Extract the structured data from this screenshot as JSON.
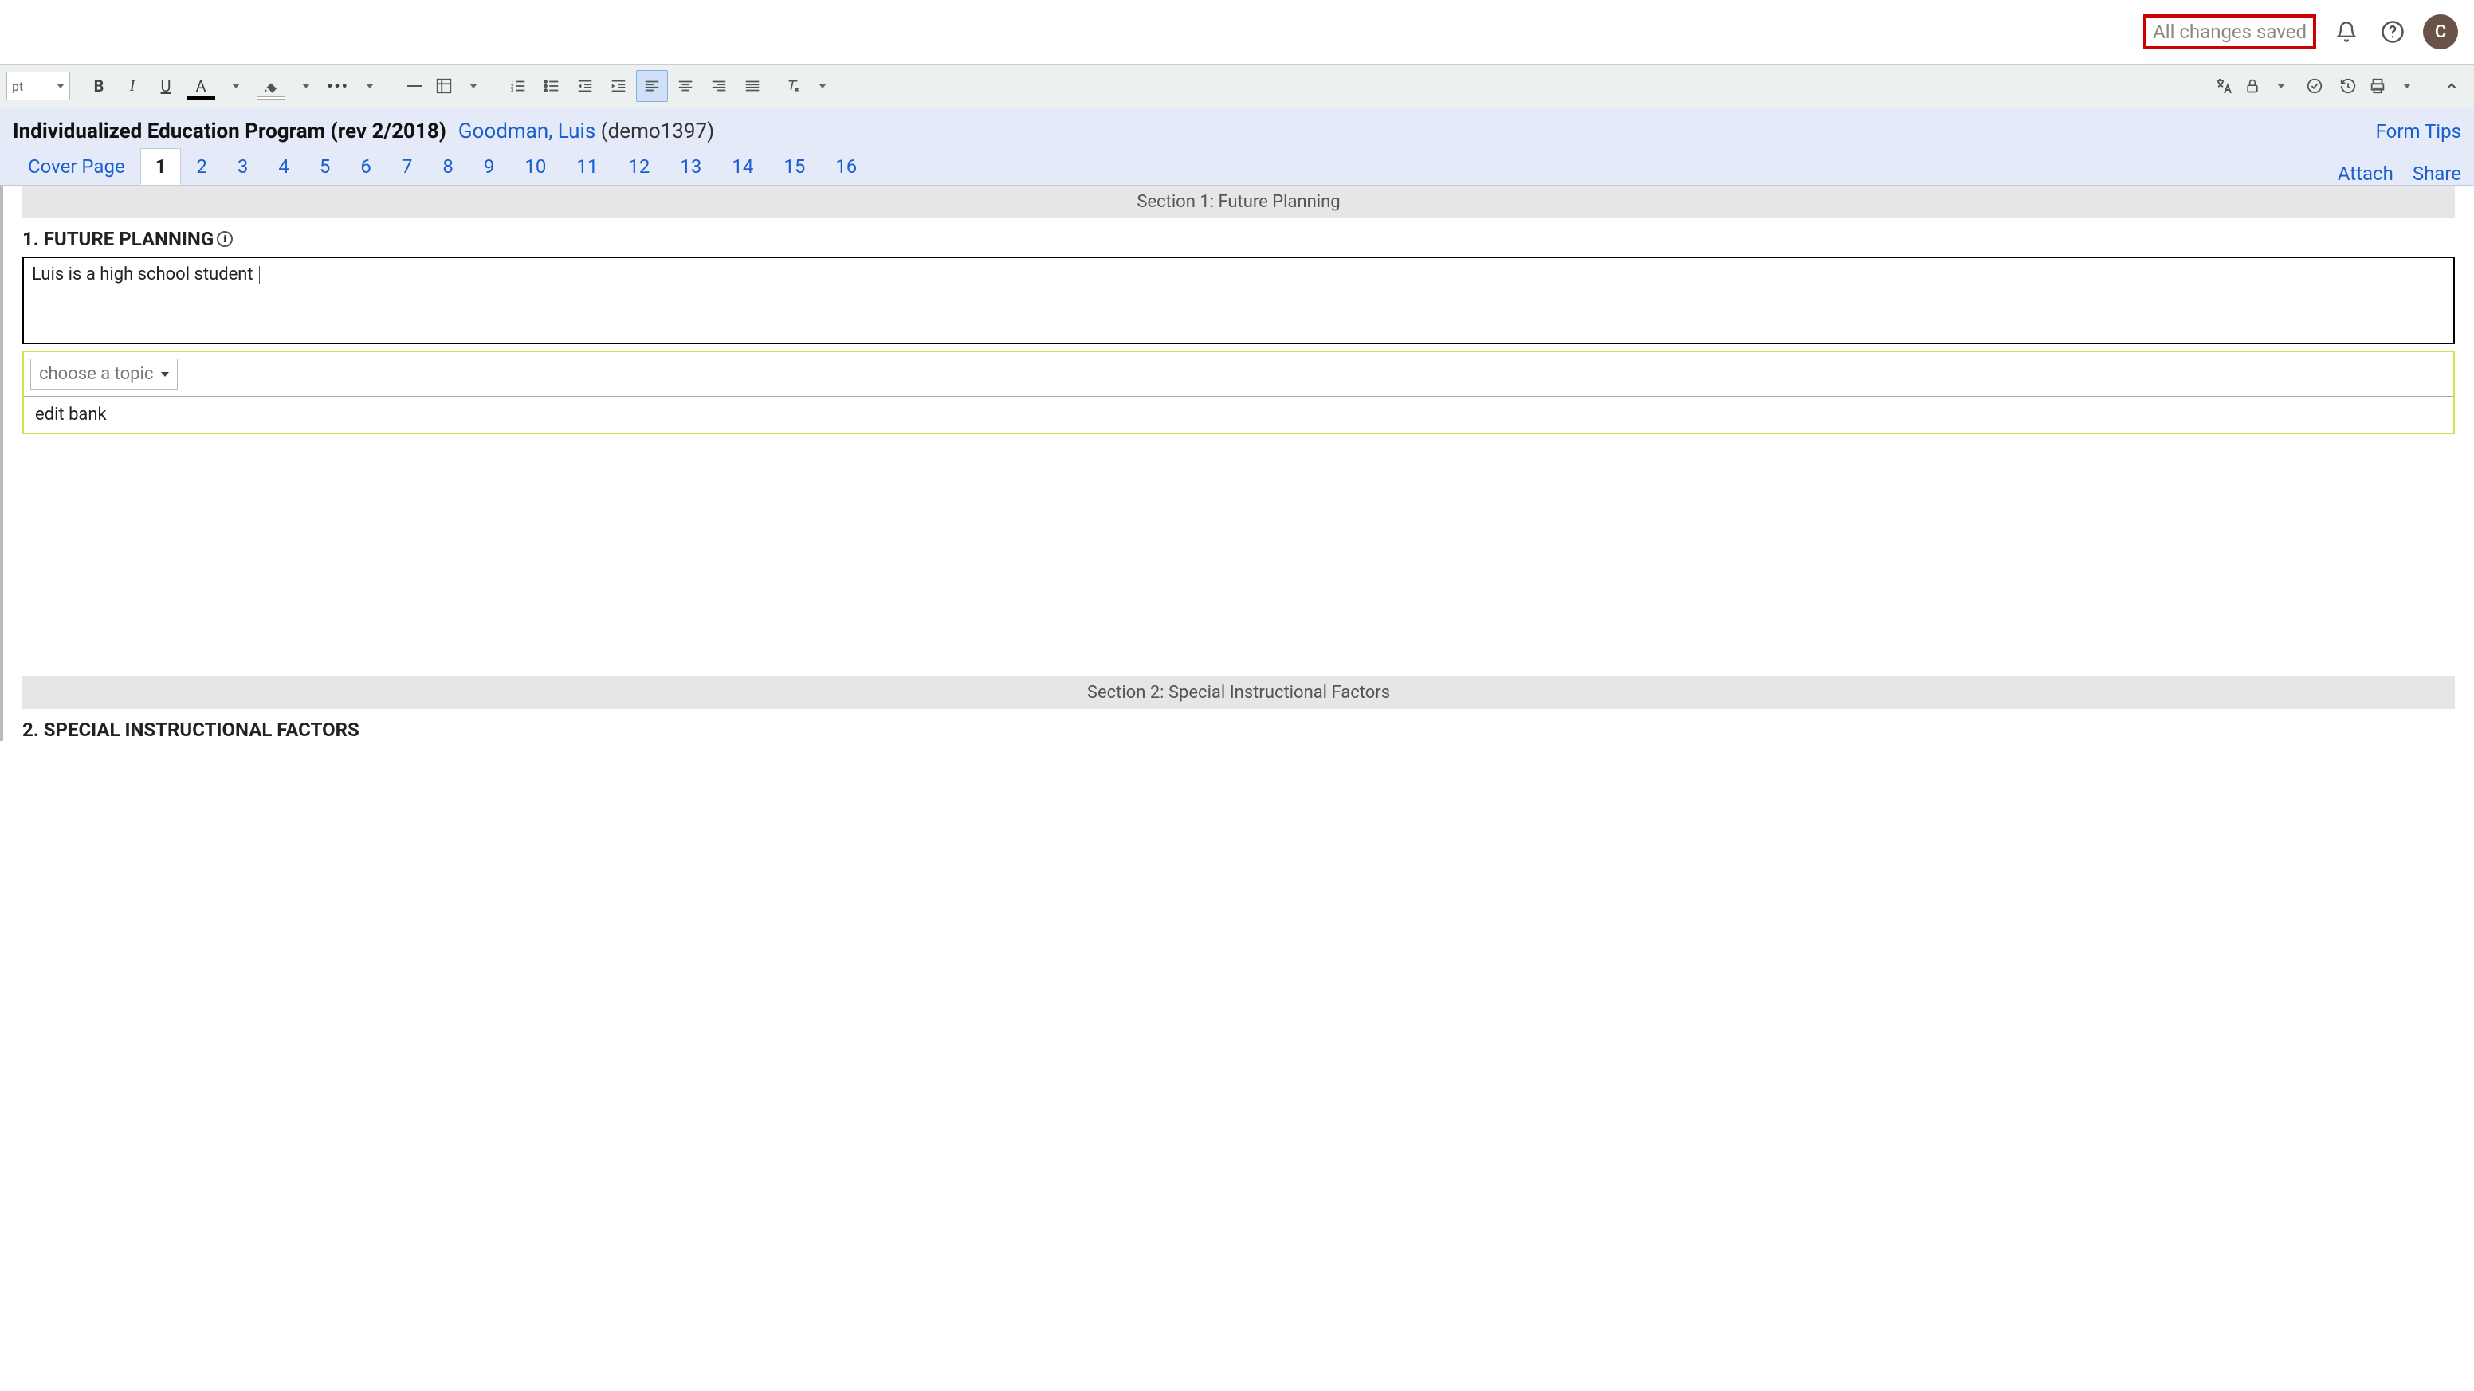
{
  "topbar": {
    "save_status": "All changes saved",
    "avatar_initial": "C"
  },
  "toolbar": {
    "font_unit": "pt"
  },
  "header": {
    "form_title": "Individualized Education Program (rev 2/2018)",
    "student_name": "Goodman, Luis",
    "student_demo": " (demo1397)",
    "form_tips": "Form Tips"
  },
  "tabs": {
    "items": [
      {
        "label": "Cover Page"
      },
      {
        "label": "1"
      },
      {
        "label": "2"
      },
      {
        "label": "3"
      },
      {
        "label": "4"
      },
      {
        "label": "5"
      },
      {
        "label": "6"
      },
      {
        "label": "7"
      },
      {
        "label": "8"
      },
      {
        "label": "9"
      },
      {
        "label": "10"
      },
      {
        "label": "11"
      },
      {
        "label": "12"
      },
      {
        "label": "13"
      },
      {
        "label": "14"
      },
      {
        "label": "15"
      },
      {
        "label": "16"
      }
    ],
    "actions": {
      "attach": "Attach",
      "share": "Share"
    }
  },
  "section1": {
    "band": "Section 1: Future Planning",
    "title": "1. FUTURE PLANNING",
    "text": "Luis is a high school student ",
    "topic_placeholder": "choose a topic",
    "edit_bank": "edit bank"
  },
  "section2": {
    "band": "Section 2: Special Instructional Factors",
    "title": "2. SPECIAL INSTRUCTIONAL FACTORS"
  }
}
